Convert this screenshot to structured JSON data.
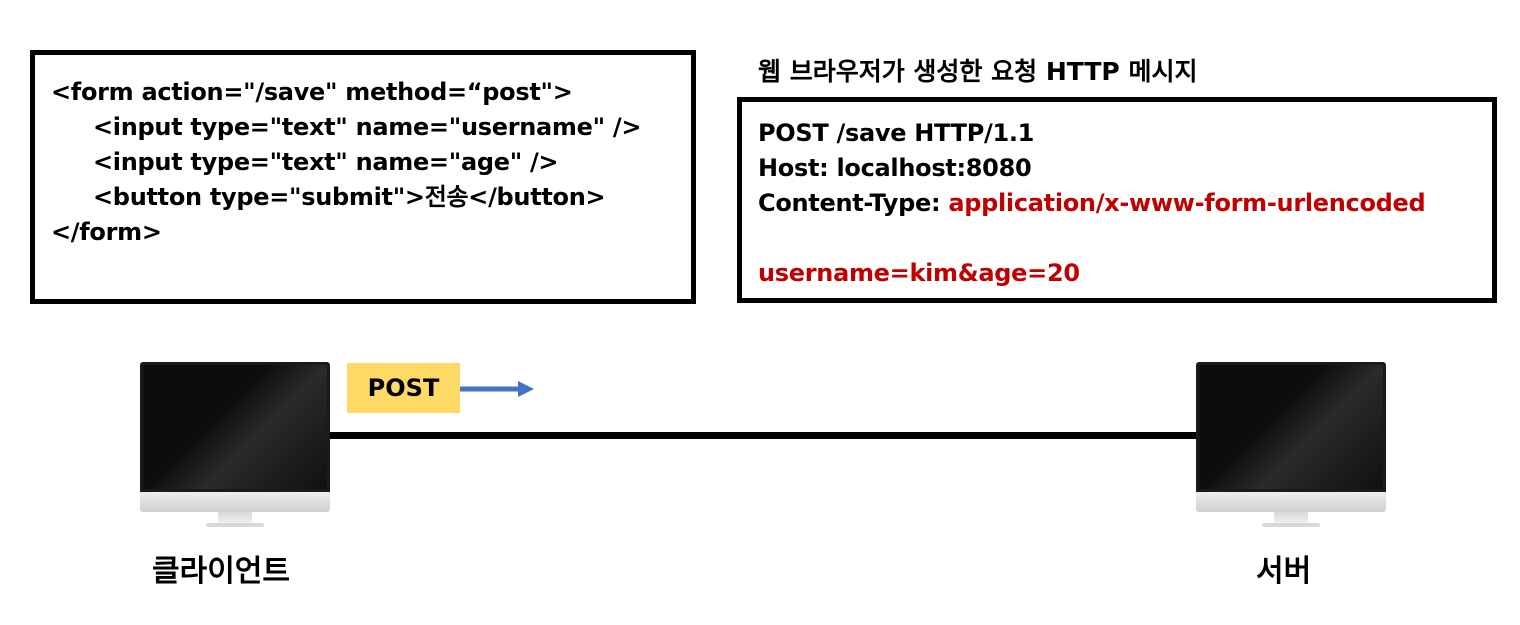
{
  "form_code": {
    "lines": [
      "<form action=\"/save\" method=“post\">",
      "<input type=\"text\" name=\"username\" />",
      "<input type=\"text\" name=\"age\" />",
      "<button type=\"submit\">전송</button>",
      "</form>"
    ]
  },
  "http_message": {
    "title": "웹 브라우저가 생성한 요청 HTTP 메시지",
    "request_line": "POST /save HTTP/1.1",
    "host_line": "Host: localhost:8080",
    "content_type_label": "Content-Type: ",
    "content_type_value": "application/x-www-form-urlencoded",
    "body": "username=kim&age=20"
  },
  "flow": {
    "method_badge": "POST",
    "client_label": "클라이언트",
    "server_label": "서버"
  },
  "colors": {
    "highlight_red": "#c00000",
    "badge_yellow": "#ffd966",
    "arrow_blue": "#4472c4"
  }
}
